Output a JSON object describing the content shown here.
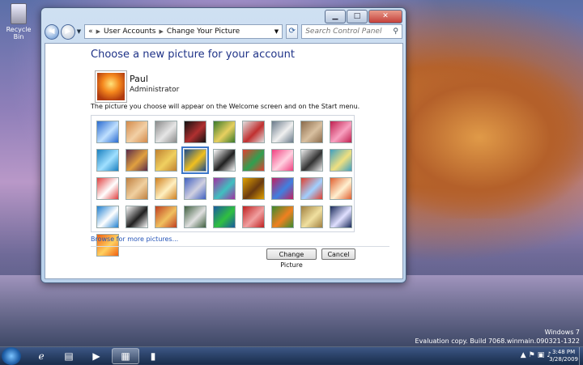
{
  "desktop": {
    "recycle_bin_label": "Recycle Bin",
    "watermark_line1": "Windows 7",
    "watermark_line2": "Evaluation copy. Build 7068.winmain.090321-1322"
  },
  "window": {
    "address": {
      "crumb1": "User Accounts",
      "crumb2": "Change Your Picture",
      "prefix": "«"
    },
    "search_placeholder": "Search Control Panel",
    "heading": "Choose a new picture for your account",
    "user": {
      "name": "Paul",
      "role": "Administrator"
    },
    "info_text": "The picture you choose will appear on the Welcome screen and on the Start menu.",
    "browse_link": "Browse for more pictures...",
    "change_button": "Change Picture",
    "cancel_button": "Cancel",
    "selected_picture": "leaf",
    "pictures": [
      {
        "name": "abstract-blue",
        "c1": "#2a6bd0",
        "c2": "#bfe0ff"
      },
      {
        "name": "starfish",
        "c1": "#d38a4a",
        "c2": "#f2d0a6"
      },
      {
        "name": "robot-head",
        "c1": "#8a8a8a",
        "c2": "#e6e6e6"
      },
      {
        "name": "record",
        "c1": "#111111",
        "c2": "#b03030"
      },
      {
        "name": "cat-toy",
        "c1": "#3a7a2a",
        "c2": "#e8d060"
      },
      {
        "name": "lucky-cat",
        "c1": "#e0e0e0",
        "c2": "#c03030"
      },
      {
        "name": "globe",
        "c1": "#6a7a8a",
        "c2": "#f0f0f0"
      },
      {
        "name": "sand",
        "c1": "#8a6a4a",
        "c2": "#d8c0a0"
      },
      {
        "name": "red-flower",
        "c1": "#c02050",
        "c2": "#f8a0c0"
      },
      {
        "name": "pinwheel",
        "c1": "#1a80c0",
        "c2": "#a0e0ff"
      },
      {
        "name": "ball",
        "c1": "#5a2a4a",
        "c2": "#e0a040"
      },
      {
        "name": "chair",
        "c1": "#c08030",
        "c2": "#f0d060"
      },
      {
        "name": "leaf",
        "c1": "#1a4a8a",
        "c2": "#f0c020"
      },
      {
        "name": "dog",
        "c1": "#ffffff",
        "c2": "#202020"
      },
      {
        "name": "crayons",
        "c1": "#e04030",
        "c2": "#30a050"
      },
      {
        "name": "pink-flower",
        "c1": "#f04080",
        "c2": "#ffd0e0"
      },
      {
        "name": "jacks",
        "c1": "#eeeeee",
        "c2": "#333333"
      },
      {
        "name": "stairs",
        "c1": "#40a0c0",
        "c2": "#f0e080"
      },
      {
        "name": "origami",
        "c1": "#e04040",
        "c2": "#ffffff"
      },
      {
        "name": "guitar",
        "c1": "#c08040",
        "c2": "#f0d0a0"
      },
      {
        "name": "puppy",
        "c1": "#d08020",
        "c2": "#fff0c0"
      },
      {
        "name": "toy-robot",
        "c1": "#4060c0",
        "c2": "#d0d0e0"
      },
      {
        "name": "fabric",
        "c1": "#a030a0",
        "c2": "#40c0c0"
      },
      {
        "name": "sunflower",
        "c1": "#e0a000",
        "c2": "#6a3a10"
      },
      {
        "name": "shell",
        "c1": "#c02060",
        "c2": "#4080e0"
      },
      {
        "name": "balloon",
        "c1": "#e04030",
        "c2": "#a0d0ff"
      },
      {
        "name": "doll",
        "c1": "#e06030",
        "c2": "#fff0d0"
      },
      {
        "name": "sailboat",
        "c1": "#2080d0",
        "c2": "#ffffff"
      },
      {
        "name": "soccer-ball",
        "c1": "#ffffff",
        "c2": "#202020"
      },
      {
        "name": "paint",
        "c1": "#c04020",
        "c2": "#f0c060"
      },
      {
        "name": "marbles",
        "c1": "#406040",
        "c2": "#e0e0e0"
      },
      {
        "name": "green-square",
        "c1": "#1a5aa0",
        "c2": "#30c040"
      },
      {
        "name": "pattern",
        "c1": "#c02020",
        "c2": "#f0a0a0"
      },
      {
        "name": "butterfly",
        "c1": "#3a8a30",
        "c2": "#f08020"
      },
      {
        "name": "spiral",
        "c1": "#a08040",
        "c2": "#f0e0a0"
      },
      {
        "name": "lantern",
        "c1": "#1a2a5a",
        "c2": "#e0e0ff"
      },
      {
        "name": "orange-flower",
        "c1": "#f06010",
        "c2": "#ffd060"
      }
    ]
  },
  "taskbar": {
    "time": "3:48 PM",
    "date": "3/28/2009",
    "items": [
      "ie",
      "explorer",
      "media-player",
      "control-panel",
      "device"
    ]
  }
}
